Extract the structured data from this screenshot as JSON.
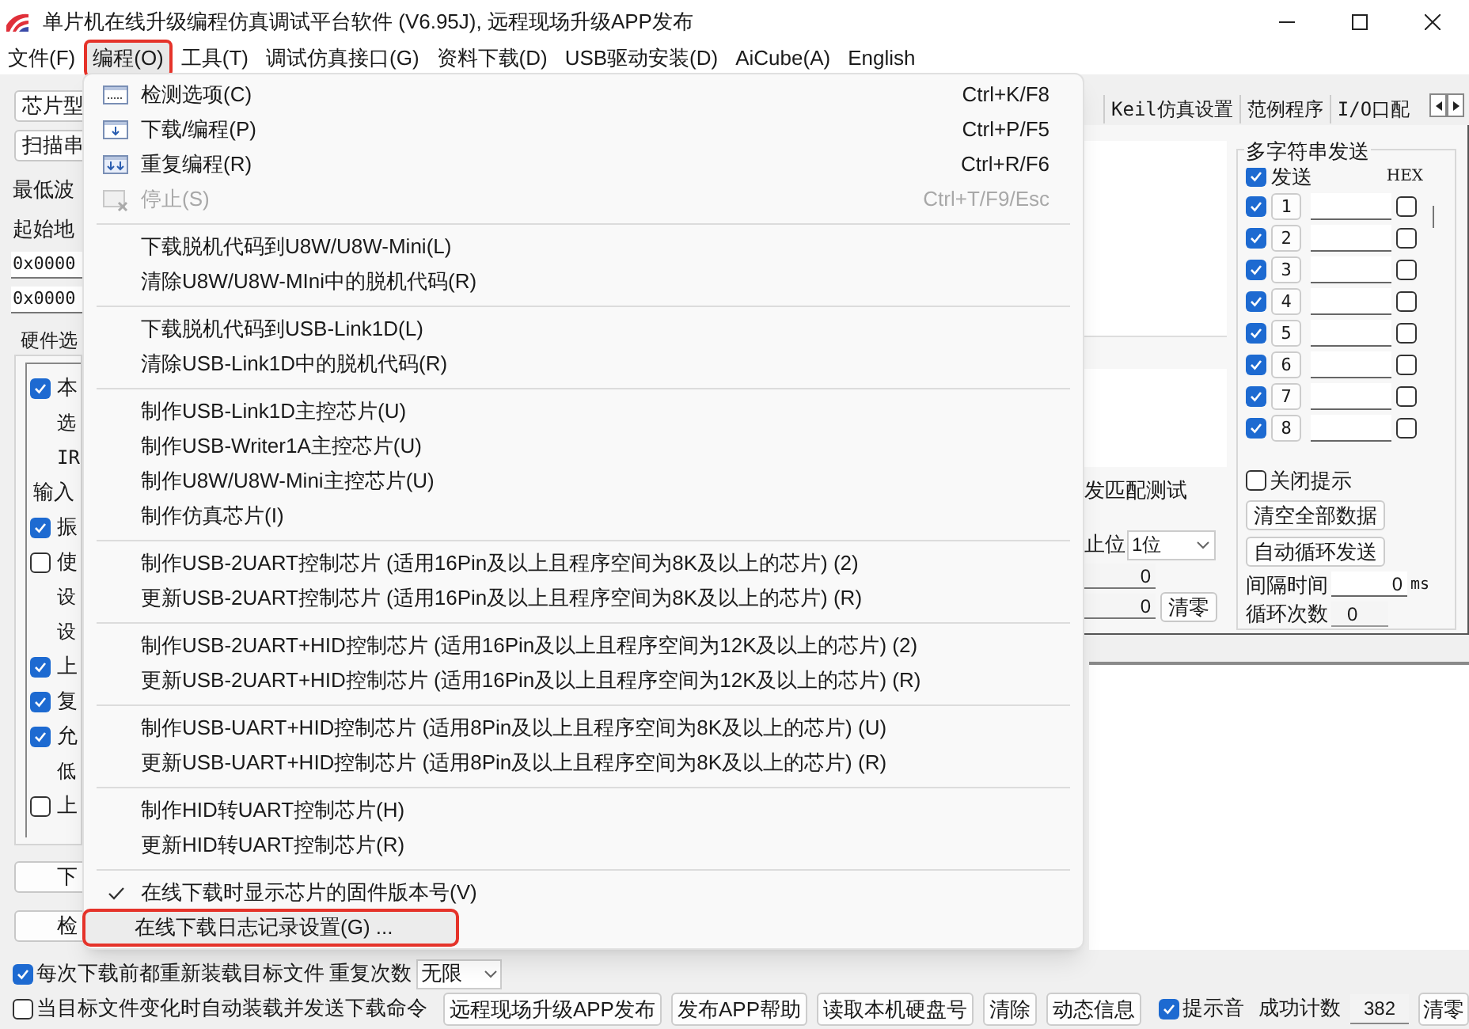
{
  "window": {
    "title": "单片机在线升级编程仿真调试平台软件 (V6.95J), 远程现场升级APP发布"
  },
  "menu_bar": [
    {
      "label": "文件(F)",
      "selected": false,
      "annotated": false
    },
    {
      "label": "编程(O)",
      "selected": true,
      "annotated": true
    },
    {
      "label": "工具(T)",
      "selected": false,
      "annotated": false
    },
    {
      "label": "调试仿真接口(G)",
      "selected": false,
      "annotated": false
    },
    {
      "label": "资料下载(D)",
      "selected": false,
      "annotated": false
    },
    {
      "label": "USB驱动安装(D)",
      "selected": false,
      "annotated": false
    },
    {
      "label": "AiCube(A)",
      "selected": false,
      "annotated": false
    },
    {
      "label": "English",
      "selected": false,
      "annotated": false
    }
  ],
  "dropdown_menu": [
    {
      "kind": "item",
      "label": "检测选项(C)",
      "shortcut": "Ctrl+K/F8",
      "disabled": false,
      "checked": false,
      "selected": false,
      "annotated": false
    },
    {
      "kind": "item",
      "label": "下载/编程(P)",
      "shortcut": "Ctrl+P/F5",
      "disabled": false,
      "checked": false,
      "selected": false,
      "annotated": false
    },
    {
      "kind": "item",
      "label": "重复编程(R)",
      "shortcut": "Ctrl+R/F6",
      "disabled": false,
      "checked": false,
      "selected": false,
      "annotated": false
    },
    {
      "kind": "item",
      "label": "停止(S)",
      "shortcut": "Ctrl+T/F9/Esc",
      "disabled": true,
      "checked": false,
      "selected": false,
      "annotated": false
    },
    {
      "kind": "separator"
    },
    {
      "kind": "item",
      "label": "下载脱机代码到U8W/U8W-Mini(L)",
      "disabled": false,
      "checked": false,
      "selected": false,
      "annotated": false
    },
    {
      "kind": "item",
      "label": "清除U8W/U8W-MIni中的脱机代码(R)",
      "disabled": false,
      "checked": false,
      "selected": false,
      "annotated": false
    },
    {
      "kind": "separator"
    },
    {
      "kind": "item",
      "label": "下载脱机代码到USB-Link1D(L)",
      "disabled": false,
      "checked": false,
      "selected": false,
      "annotated": false
    },
    {
      "kind": "item",
      "label": "清除USB-Link1D中的脱机代码(R)",
      "disabled": false,
      "checked": false,
      "selected": false,
      "annotated": false
    },
    {
      "kind": "separator"
    },
    {
      "kind": "item",
      "label": "制作USB-Link1D主控芯片(U)",
      "disabled": false,
      "checked": false,
      "selected": false,
      "annotated": false
    },
    {
      "kind": "item",
      "label": "制作USB-Writer1A主控芯片(U)",
      "disabled": false,
      "checked": false,
      "selected": false,
      "annotated": false
    },
    {
      "kind": "item",
      "label": "制作U8W/U8W-Mini主控芯片(U)",
      "disabled": false,
      "checked": false,
      "selected": false,
      "annotated": false
    },
    {
      "kind": "item",
      "label": "制作仿真芯片(I)",
      "disabled": false,
      "checked": false,
      "selected": false,
      "annotated": false
    },
    {
      "kind": "separator"
    },
    {
      "kind": "item",
      "label": "制作USB-2UART控制芯片 (适用16Pin及以上且程序空间为8K及以上的芯片) (2)",
      "disabled": false,
      "checked": false,
      "selected": false,
      "annotated": false
    },
    {
      "kind": "item",
      "label": "更新USB-2UART控制芯片 (适用16Pin及以上且程序空间为8K及以上的芯片) (R)",
      "disabled": false,
      "checked": false,
      "selected": false,
      "annotated": false
    },
    {
      "kind": "separator"
    },
    {
      "kind": "item",
      "label": "制作USB-2UART+HID控制芯片 (适用16Pin及以上且程序空间为12K及以上的芯片) (2)",
      "disabled": false,
      "checked": false,
      "selected": false,
      "annotated": false
    },
    {
      "kind": "item",
      "label": "更新USB-2UART+HID控制芯片 (适用16Pin及以上且程序空间为12K及以上的芯片) (R)",
      "disabled": false,
      "checked": false,
      "selected": false,
      "annotated": false
    },
    {
      "kind": "separator"
    },
    {
      "kind": "item",
      "label": "制作USB-UART+HID控制芯片 (适用8Pin及以上且程序空间为8K及以上的芯片) (U)",
      "disabled": false,
      "checked": false,
      "selected": false,
      "annotated": false
    },
    {
      "kind": "item",
      "label": "更新USB-UART+HID控制芯片 (适用8Pin及以上且程序空间为8K及以上的芯片) (R)",
      "disabled": false,
      "checked": false,
      "selected": false,
      "annotated": false
    },
    {
      "kind": "separator"
    },
    {
      "kind": "item",
      "label": "制作HID转UART控制芯片(H)",
      "disabled": false,
      "checked": false,
      "selected": false,
      "annotated": false
    },
    {
      "kind": "item",
      "label": "更新HID转UART控制芯片(R)",
      "disabled": false,
      "checked": false,
      "selected": false,
      "annotated": false
    },
    {
      "kind": "separator"
    },
    {
      "kind": "item",
      "label": "在线下载时显示芯片的固件版本号(V)",
      "disabled": false,
      "checked": true,
      "selected": false,
      "annotated": false
    },
    {
      "kind": "item",
      "label": "在线下载日志记录设置(G) ...",
      "disabled": false,
      "checked": false,
      "selected": true,
      "annotated": true
    }
  ],
  "left_panel": [
    {
      "kind": "button",
      "label": "芯片型"
    },
    {
      "kind": "button",
      "label": "扫描串"
    },
    {
      "kind": "label",
      "label": "最低波"
    },
    {
      "kind": "label",
      "label": "起始地"
    },
    {
      "kind": "field",
      "value": "0x0000"
    },
    {
      "kind": "field",
      "value": "0x0000"
    },
    {
      "kind": "group",
      "label": "硬件选",
      "rows": [
        {
          "kind": "check",
          "label": "本",
          "checked": true
        },
        {
          "kind": "note",
          "label": "选"
        },
        {
          "kind": "note",
          "label": "IR"
        },
        {
          "kind": "heading",
          "label": "输入"
        },
        {
          "kind": "check",
          "label": "振",
          "checked": true
        },
        {
          "kind": "check",
          "label": "使",
          "checked": false
        },
        {
          "kind": "note",
          "label": "设"
        },
        {
          "kind": "note",
          "label": "设"
        },
        {
          "kind": "check",
          "label": "上",
          "checked": true
        },
        {
          "kind": "check",
          "label": "复",
          "checked": true
        },
        {
          "kind": "check",
          "label": "允",
          "checked": true
        },
        {
          "kind": "note",
          "label": "低"
        },
        {
          "kind": "check",
          "label": "上",
          "checked": false
        }
      ]
    },
    {
      "kind": "wide_button",
      "label": "下"
    },
    {
      "kind": "wide_button",
      "label": "检"
    }
  ],
  "tabs": [
    {
      "label": "Keil仿真设置",
      "selected": false
    },
    {
      "label": "范例程序",
      "selected": false
    },
    {
      "label": "I/O口配",
      "selected": false
    }
  ],
  "serial_panel": {
    "match_test_label": "发匹配测试",
    "stop_bit_label": "止位",
    "stop_bit_value": "1位",
    "rx_count": "0",
    "tx_count": "0",
    "clear_button": "清零"
  },
  "multi_send": {
    "title": "多字符串发送",
    "send_all": {
      "label": "发送",
      "checked": true
    },
    "hex_header": "HEX",
    "rows": [
      {
        "enabled": true,
        "number": "1",
        "hex": false
      },
      {
        "enabled": true,
        "number": "2",
        "hex": false
      },
      {
        "enabled": true,
        "number": "3",
        "hex": false
      },
      {
        "enabled": true,
        "number": "4",
        "hex": false
      },
      {
        "enabled": true,
        "number": "5",
        "hex": false
      },
      {
        "enabled": true,
        "number": "6",
        "hex": false
      },
      {
        "enabled": true,
        "number": "7",
        "hex": false
      },
      {
        "enabled": true,
        "number": "8",
        "hex": false
      }
    ],
    "close_tip": {
      "label": "关闭提示",
      "checked": false
    },
    "clear_all_button": "清空全部数据",
    "auto_loop_button": "自动循环发送",
    "interval_label": "间隔时间",
    "interval_value": "0",
    "interval_unit": "ms",
    "loop_count_label": "循环次数",
    "loop_count_value": "0"
  },
  "bottom": {
    "reload_checkbox": {
      "label": "每次下载前都重新装载目标文件",
      "checked": true
    },
    "repeat_label": "重复次数",
    "repeat_value": "无限",
    "auto_checkbox": {
      "label": "当目标文件变化时自动装载并发送下载命令",
      "checked": false
    },
    "buttons": [
      "远程现场升级APP发布",
      "发布APP帮助",
      "读取本机硬盘号",
      "清除",
      "动态信息"
    ],
    "beep": {
      "label": "提示音",
      "checked": true
    },
    "success_label": "成功计数",
    "success_count": "382",
    "reset_button": "清零"
  }
}
